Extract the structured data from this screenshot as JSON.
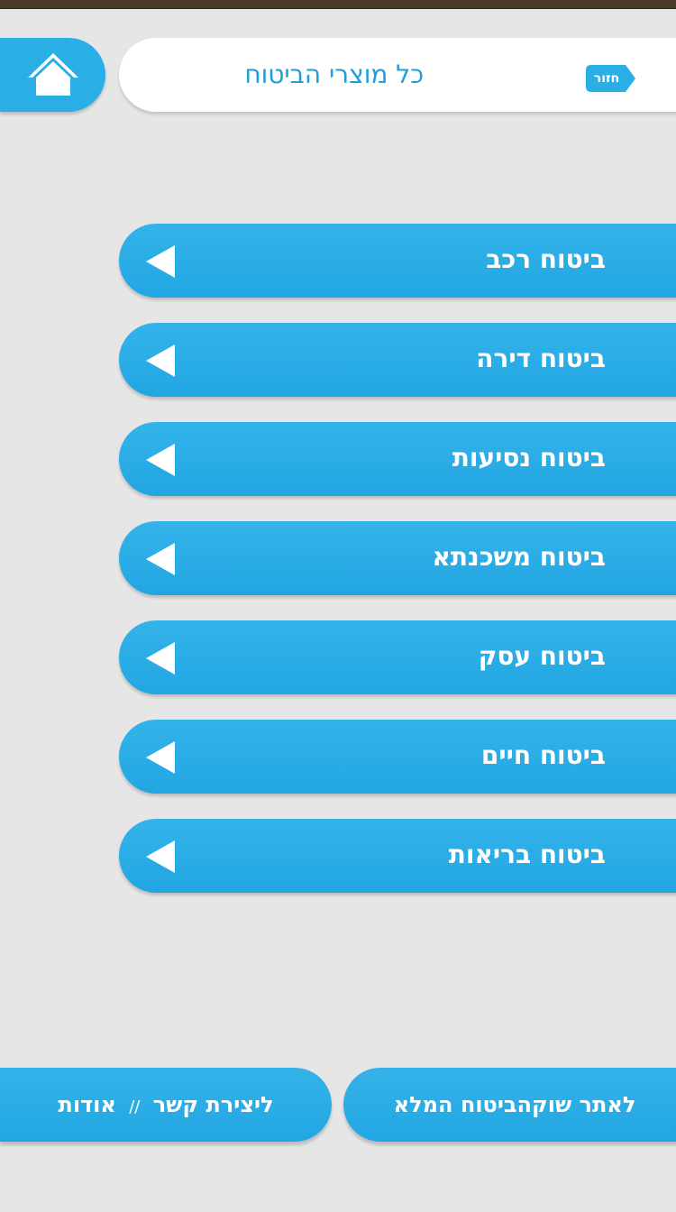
{
  "header": {
    "title": "כל מוצרי הביטוח",
    "back_label": "חזור"
  },
  "menu": {
    "items": [
      {
        "label": "ביטוח רכב"
      },
      {
        "label": "ביטוח דירה"
      },
      {
        "label": "ביטוח נסיעות"
      },
      {
        "label": "ביטוח משכנתא"
      },
      {
        "label": "ביטוח עסק"
      },
      {
        "label": "ביטוח חיים"
      },
      {
        "label": "ביטוח בריאות"
      }
    ]
  },
  "footer": {
    "site_link": "לאתר שוקהביטוח המלא",
    "contact": "ליצירת קשר",
    "separator": "//",
    "about": "אודות"
  },
  "colors": {
    "accent": "#29aee6",
    "title": "#1e9fd7",
    "background": "#e6e6e6"
  },
  "icons": {
    "home": "home-icon",
    "arrow": "left-triangle-icon"
  }
}
